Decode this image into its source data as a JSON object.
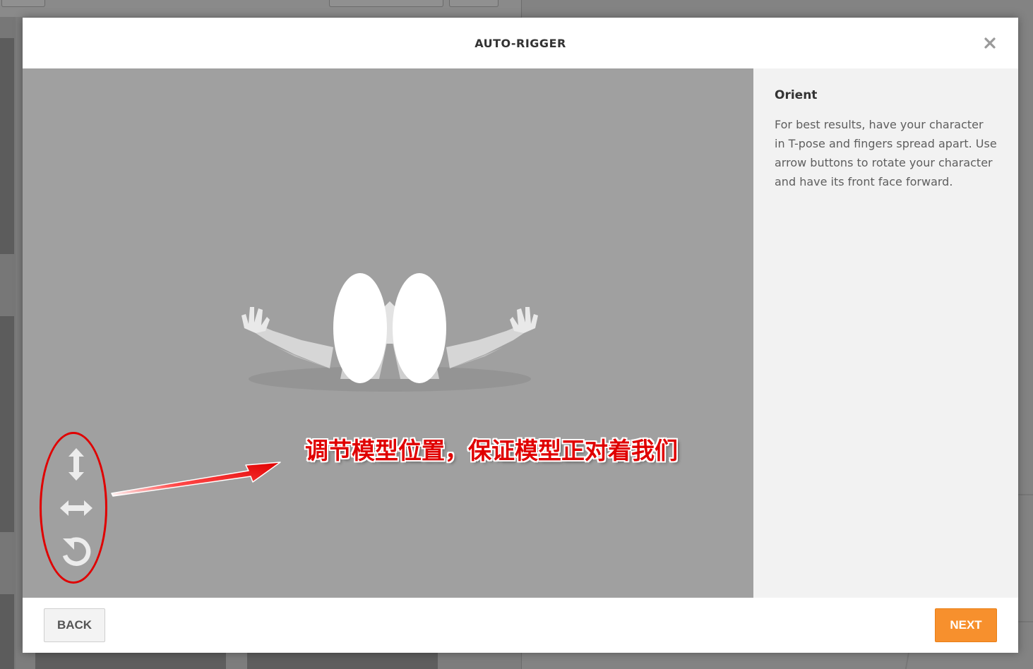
{
  "modal": {
    "title": "AUTO-RIGGER",
    "close_icon": "close-icon"
  },
  "side_panel": {
    "title": "Orient",
    "description": "For best results, have your character in T-pose and fingers spread apart. Use arrow buttons to rotate your character and have its front face forward."
  },
  "view_controls": {
    "icons": [
      "vertical-arrow-icon",
      "horizontal-arrow-icon",
      "rotate-icon"
    ]
  },
  "annotation": {
    "text": "调节模型位置，保证模型正对着我们",
    "color": "#e00000"
  },
  "footer": {
    "back_label": "BACK",
    "next_label": "NEXT",
    "next_color": "#f7902d"
  }
}
